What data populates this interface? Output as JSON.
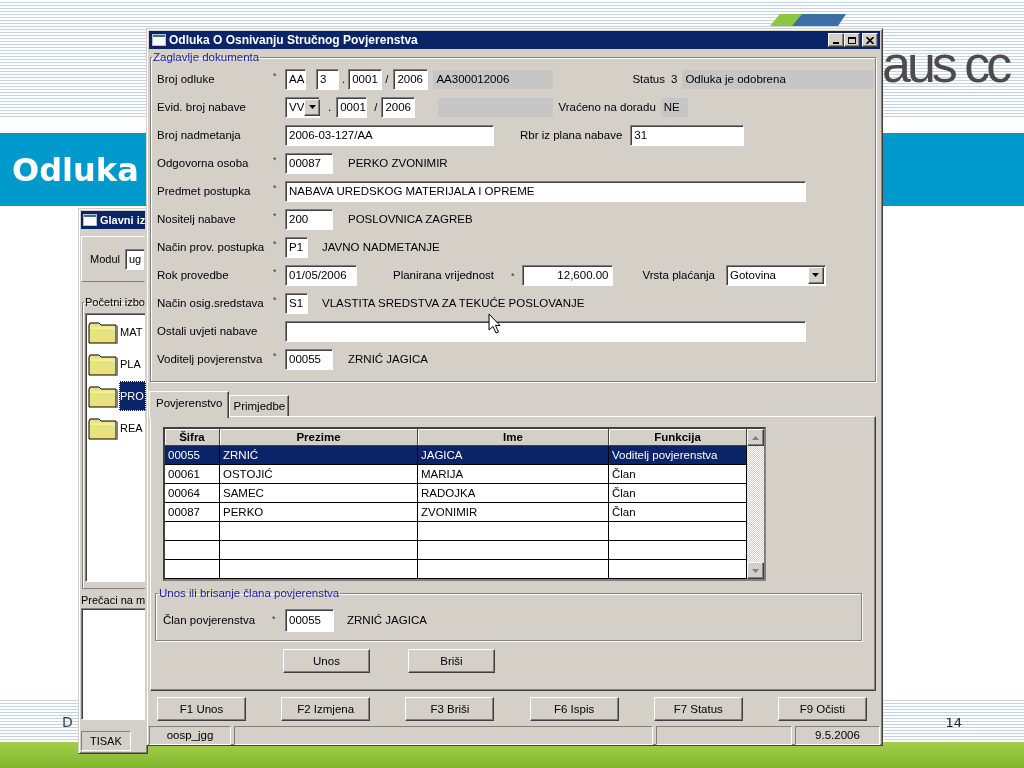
{
  "slide": {
    "title": "Odluka",
    "logo_text": "aus cc",
    "footer_text": "D",
    "page_number": "14"
  },
  "main_window": {
    "title": "Glavni iz",
    "module_label": "Modul",
    "module_value": "ug",
    "tree_legend": "Početni izbo",
    "folders": [
      {
        "label": "MAT",
        "selected": false
      },
      {
        "label": "PLA",
        "selected": false
      },
      {
        "label": "PRO",
        "selected": true
      },
      {
        "label": "REA",
        "selected": false
      }
    ],
    "shortcuts_label": "Prečaci na m",
    "status_bar": [
      "TISAK"
    ]
  },
  "dialog": {
    "title": "Odluka O Osnivanju Stručnog Povjerenstva",
    "header": {
      "legend": "Zaglavlje dokumenta",
      "rows": [
        {
          "label": "Broj odluke",
          "mark": "*",
          "items": [
            {
              "kind": "input",
              "value": "AA"
            },
            {
              "kind": "input",
              "value": "3"
            },
            {
              "kind": "separator",
              "value": "."
            },
            {
              "kind": "input",
              "value": "0001"
            },
            {
              "kind": "separator",
              "value": "/"
            },
            {
              "kind": "input",
              "value": "2006"
            },
            {
              "kind": "readonly",
              "value": "AA300012006"
            },
            {
              "kind": "label",
              "value": "Status"
            },
            {
              "kind": "value",
              "value": "3"
            },
            {
              "kind": "readonly",
              "value": "Odluka je odobrena"
            }
          ]
        },
        {
          "label": "Evid. broj nabave",
          "items": [
            {
              "kind": "combo",
              "value": "VV"
            },
            {
              "kind": "separator",
              "value": "."
            },
            {
              "kind": "input",
              "value": "0001"
            },
            {
              "kind": "separator",
              "value": "/"
            },
            {
              "kind": "input",
              "value": "2006"
            },
            {
              "kind": "readonly"
            },
            {
              "kind": "label",
              "value": "Vraćeno na doradu"
            },
            {
              "kind": "readonly",
              "value": "NE"
            }
          ]
        },
        {
          "label": "Broj nadmetanja",
          "items": [
            {
              "kind": "input",
              "value": "2006-03-127/AA"
            },
            {
              "kind": "label",
              "value": "Rbr iz plana nabave"
            },
            {
              "kind": "input",
              "value": "31"
            }
          ]
        },
        {
          "label": "Odgovorna osoba",
          "mark": "*",
          "items": [
            {
              "kind": "input",
              "value": "00087"
            },
            {
              "kind": "value",
              "value": "PERKO ZVONIMIR"
            }
          ]
        },
        {
          "label": "Predmet postupka",
          "mark": "*",
          "items": [
            {
              "kind": "input",
              "value": "NABAVA UREDSKOG MATERIJALA I OPREME"
            }
          ]
        },
        {
          "label": "Nositelj nabave",
          "mark": "*",
          "items": [
            {
              "kind": "input",
              "value": "200"
            },
            {
              "kind": "value",
              "value": "POSLOVNICA ZAGREB"
            }
          ]
        },
        {
          "label": "Način prov. postupka",
          "mark": "*",
          "items": [
            {
              "kind": "input",
              "value": "P1"
            },
            {
              "kind": "value",
              "value": "JAVNO NADMETANJE"
            }
          ]
        },
        {
          "label": "Rok provedbe",
          "mark": "*",
          "items": [
            {
              "kind": "input",
              "value": "01/05/2006"
            },
            {
              "kind": "label",
              "value": "Planirana vrijednost"
            },
            {
              "kind": "mark",
              "value": "*"
            },
            {
              "kind": "number",
              "value": "12,600.00"
            },
            {
              "kind": "label",
              "value": "Vrsta plaćanja"
            },
            {
              "kind": "combo",
              "value": "Gotovina"
            }
          ]
        },
        {
          "label": "Način osig.sredstava",
          "mark": "*",
          "items": [
            {
              "kind": "input",
              "value": "S1"
            },
            {
              "kind": "value",
              "value": "VLASTITA SREDSTVA ZA TEKUĆE POSLOVANJE"
            }
          ]
        },
        {
          "label": "Ostali uvjeti nabave",
          "items": [
            {
              "kind": "input"
            }
          ]
        },
        {
          "label": "Voditelj povjerenstva",
          "mark": "*",
          "items": [
            {
              "kind": "input",
              "value": "00055"
            },
            {
              "kind": "value",
              "value": "ZRNIĆ JAGICA"
            }
          ]
        }
      ]
    },
    "tabs": [
      {
        "label": "Povjerenstvo",
        "selected": true
      },
      {
        "label": "Primjedbe",
        "selected": false
      }
    ],
    "table": {
      "columns": [
        "Šifra",
        "Prezime",
        "Ime",
        "Funkcija"
      ],
      "rows": [
        {
          "cells": [
            "00055",
            "ZRNIĆ",
            "JAGICA",
            "Voditelj povjerenstva"
          ],
          "selected": true
        },
        {
          "cells": [
            "00061",
            "OSTOJIĆ",
            "MARIJA",
            "Član"
          ],
          "selected": false
        },
        {
          "cells": [
            "00064",
            "SAMEC",
            "RADOJKA",
            "Član"
          ],
          "selected": false
        },
        {
          "cells": [
            "00087",
            "PERKO",
            "ZVONIMIR",
            "Član"
          ],
          "selected": false
        }
      ]
    },
    "member": {
      "legend": "Unos ili brisanje člana povjerenstva",
      "label": "Član povjerenstva",
      "mark": "*",
      "value": "00055",
      "name": "ZRNIĆ JAGICA"
    },
    "panel_buttons": [
      "Unos",
      "Briši"
    ],
    "function_buttons": [
      "F1 Unos",
      "F2 Izmjena",
      "F3 Briši",
      "F6 Ispis",
      "F7 Status",
      "F9 Očisti"
    ],
    "status_bar": {
      "user": "oosp_jgg",
      "date": "9.5.2006"
    }
  }
}
